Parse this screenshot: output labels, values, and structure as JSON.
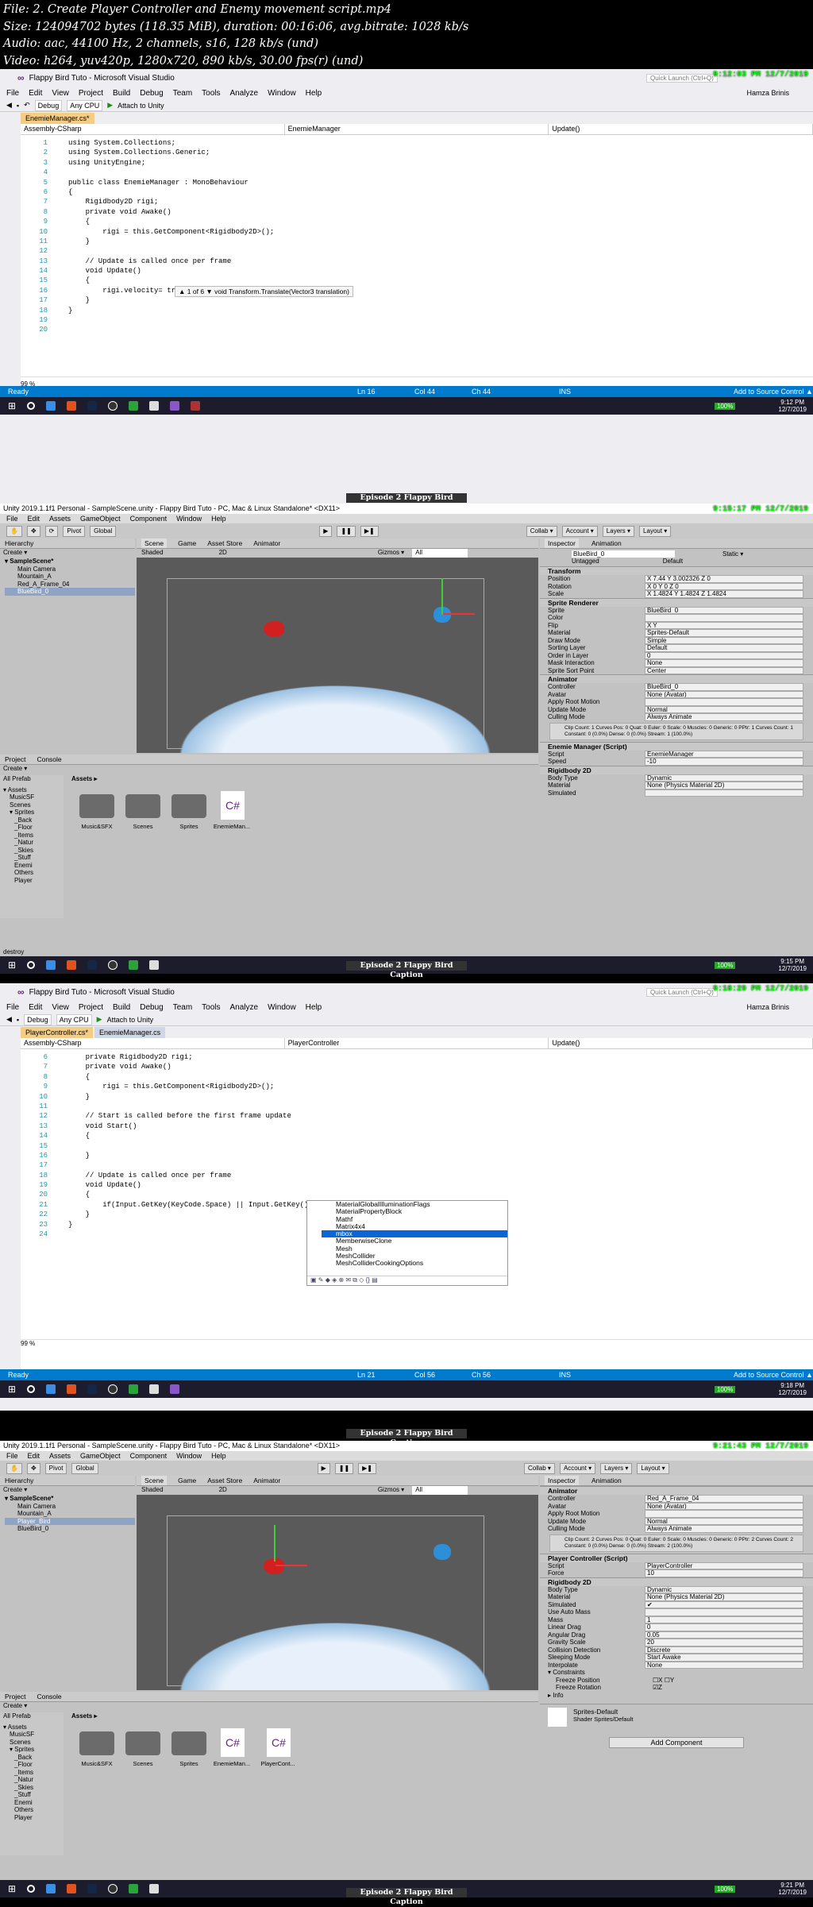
{
  "header": {
    "line1": "File: 2. Create Player Controller and Enemy movement script.mp4",
    "line2": "Size: 124094702 bytes (118.35 MiB), duration: 00:16:06, avg.bitrate: 1028 kb/s",
    "line3": "Audio: aac, 44100 Hz, 2 channels, s16, 128 kb/s (und)",
    "line4": "Video: h264, yuv420p, 1280x720, 890 kb/s, 30.00 fps(r) (und)"
  },
  "frame1": {
    "stamp": "9:12:03 PM 12/7/2019",
    "title": "Flappy Bird Tuto - Microsoft Visual Studio",
    "quick_launch": "Quick Launch (Ctrl+Q)",
    "user": "Hamza Brinis",
    "menu": [
      "File",
      "Edit",
      "View",
      "Project",
      "Build",
      "Debug",
      "Team",
      "Tools",
      "Analyze",
      "Window",
      "Help"
    ],
    "config": "Debug",
    "platform": "Any CPU",
    "attach": "Attach to Unity",
    "tab": "EnemieManager.cs*",
    "nav": [
      "Assembly-CSharp",
      "EnemieManager",
      "Update()"
    ],
    "lines": [
      "1",
      "2",
      "3",
      "4",
      "5",
      "6",
      "7",
      "8",
      "9",
      "10",
      "11",
      "12",
      "13",
      "14",
      "15",
      "16",
      "17",
      "18",
      "19",
      "20"
    ],
    "code": [
      "using System.Collections;",
      "using System.Collections.Generic;",
      "using UnityEngine;",
      "",
      "public class EnemieManager : MonoBehaviour",
      "{",
      "    Rigidbody2D rigi;",
      "    private void Awake()",
      "    {",
      "        rigi = this.GetComponent<Rigidbody2D>();",
      "    }",
      "",
      "    // Update is called once per frame",
      "    void Update()",
      "    {",
      "        rigi.velocity= transform.Translate()",
      "    }",
      "}",
      "",
      ""
    ],
    "tooltip": "▲ 1 of 6 ▼  void Transform.Translate(Vector3 translation)",
    "zoom": "99 %",
    "status": {
      "ready": "Ready",
      "ln": "Ln 16",
      "col": "Col 44",
      "ch": "Ch 44",
      "ins": "INS",
      "source": "Add to Source Control ▲"
    },
    "clock": {
      "time": "9:12 PM",
      "date": "12/7/2019"
    }
  },
  "frame2": {
    "stamp": "9:15:17 PM 12/7/2019",
    "title": "Unity 2019.1.1f1 Personal - SampleScene.unity - Flappy Bird Tuto - PC, Mac & Linux Standalone* <DX11>",
    "menu": [
      "File",
      "Edit",
      "Assets",
      "GameObject",
      "Component",
      "Window",
      "Help"
    ],
    "toolbar": {
      "pivot": "Pivot",
      "global": "Global",
      "collab": "Collab ▾",
      "account": "Account ▾",
      "layers": "Layers ▾",
      "layout": "Layout ▾"
    },
    "hierarchy": {
      "tab": "Hierarchy",
      "create": "Create ▾",
      "items": [
        "▾ SampleScene*",
        "Main Camera",
        "Mountain_A",
        "Red_A_Frame_04",
        "BlueBird_0"
      ]
    },
    "scene_tabs": [
      "Scene",
      "Game",
      "Asset Store",
      "Animator"
    ],
    "scene_opts": {
      "shaded": "Shaded",
      "mode": "2D",
      "gizmos": "Gizmos ▾",
      "search": "All"
    },
    "inspector": {
      "tabs": [
        "Inspector",
        "Animation"
      ],
      "object": "BlueBird_0",
      "static": "Static ▾",
      "tag": "Untagged",
      "layer": "Default",
      "transform": "Transform",
      "rows": [
        [
          "Position",
          "X 7.44   Y 3.002326   Z 0"
        ],
        [
          "Rotation",
          "X 0   Y 0   Z 0"
        ],
        [
          "Scale",
          "X 1.4824   Y 1.4824   Z 1.4824"
        ]
      ],
      "sprite_renderer": "Sprite Renderer",
      "sr_rows": [
        [
          "Sprite",
          "BlueBird_0"
        ],
        [
          "Color",
          ""
        ],
        [
          "Flip",
          "X  Y"
        ],
        [
          "Material",
          "Sprites-Default"
        ],
        [
          "Draw Mode",
          "Simple"
        ],
        [
          "Sorting Layer",
          "Default"
        ],
        [
          "Order in Layer",
          "0"
        ],
        [
          "Mask Interaction",
          "None"
        ],
        [
          "Sprite Sort Point",
          "Center"
        ]
      ],
      "animator": "Animator",
      "an_rows": [
        [
          "Controller",
          "BlueBird_0"
        ],
        [
          "Avatar",
          "None (Avatar)"
        ],
        [
          "Apply Root Motion",
          ""
        ],
        [
          "Update Mode",
          "Normal"
        ],
        [
          "Culling Mode",
          "Always Animate"
        ]
      ],
      "clip": "Clip Count: 1  Curves Pos: 0 Quat: 0 Euler: 0 Scale: 0 Muscles: 0 Generic: 0 PPtr: 1  Curves Count: 1 Constant: 0 (0.0%) Dense: 0 (0.0%) Stream: 1 (100.0%)",
      "script_comp": "Enemie Manager (Script)",
      "script_rows": [
        [
          "Script",
          "EnemieManager"
        ],
        [
          "Speed",
          "-10"
        ]
      ],
      "rigidbody": "Rigidbody 2D",
      "rb_rows": [
        [
          "Body Type",
          "Dynamic"
        ],
        [
          "Material",
          "None (Physics Material 2D)"
        ],
        [
          "Simulated",
          ""
        ]
      ]
    },
    "project": {
      "tabs": [
        "Project",
        "Console"
      ],
      "create": "Create ▾",
      "path": "Assets ▸",
      "favorites": "All Prefab",
      "tree": [
        "▾ Assets",
        "MusicSF",
        "Scenes",
        "▾ Sprites",
        "_Back",
        "_Floor",
        "_Items",
        "_Natur",
        "_Skies",
        "_Stuff",
        "Enemi",
        "Others",
        "Player"
      ],
      "assets": [
        "Music&SFX",
        "Scenes",
        "Sprites",
        "EnemieMan..."
      ]
    },
    "console": "destroy",
    "clock": {
      "time": "9:15 PM",
      "date": "12/7/2019"
    }
  },
  "frame3": {
    "stamp": "9:18:29 PM 12/7/2019",
    "title": "Flappy Bird Tuto - Microsoft Visual Studio",
    "quick_launch": "Quick Launch (Ctrl+Q)",
    "user": "Hamza Brinis",
    "tabs": [
      "PlayerController.cs*",
      "EnemieManager.cs"
    ],
    "nav": [
      "Assembly-CSharp",
      "PlayerController",
      "Update()"
    ],
    "lines": [
      "6",
      "7",
      "8",
      "9",
      "10",
      "11",
      "12",
      "13",
      "14",
      "15",
      "16",
      "17",
      "18",
      "19",
      "20",
      "21",
      "22",
      "23",
      "24"
    ],
    "code": [
      "    private Rigidbody2D rigi;",
      "    private void Awake()",
      "    {",
      "        rigi = this.GetComponent<Rigidbody2D>();",
      "    }",
      "",
      "    // Start is called before the first frame update",
      "    void Start()",
      "    {",
      "",
      "    }",
      "",
      "    // Update is called once per frame",
      "    void Update()",
      "    {",
      "        if(Input.GetKey(KeyCode.Space) || Input.GetKey()_",
      "    }",
      "}",
      ""
    ],
    "autocomplete": [
      "MaterialGlobalIlluminationFlags",
      "MaterialPropertyBlock",
      "Mathf",
      "Matrix4x4",
      "mbox",
      "MemberwiseClone",
      "Mesh",
      "MeshCollider",
      "MeshColliderCookingOptions"
    ],
    "zoom": "99 %",
    "status": {
      "ready": "Ready",
      "ln": "Ln 21",
      "col": "Col 56",
      "ch": "Ch 56",
      "ins": "INS",
      "source": "Add to Source Control ▲"
    },
    "clock": {
      "time": "9:18 PM",
      "date": "12/7/2019"
    }
  },
  "frame4": {
    "stamp": "9:21:43 PM 12/7/2019",
    "title": "Unity 2019.1.1f1 Personal - SampleScene.unity - Flappy Bird Tuto - PC, Mac & Linux Standalone* <DX11>",
    "hierarchy": {
      "items": [
        "▾ SampleScene*",
        "Main Camera",
        "Mountain_A",
        "Player_Bird",
        "BlueBird_0"
      ]
    },
    "inspector": {
      "animator": "Animator",
      "an_rows": [
        [
          "Controller",
          "Red_A_Frame_04"
        ],
        [
          "Avatar",
          "None (Avatar)"
        ],
        [
          "Apply Root Motion",
          ""
        ],
        [
          "Update Mode",
          "Normal"
        ],
        [
          "Culling Mode",
          "Always Animate"
        ]
      ],
      "clip": "Clip Count: 2  Curves Pos: 0 Quat: 0 Euler: 0 Scale: 0 Muscles: 0 Generic: 0 PPtr: 2  Curves Count: 2 Constant: 0 (0.0%) Dense: 0 (0.0%) Stream: 2 (100.0%)",
      "script_comp": "Player Controller (Script)",
      "script_rows": [
        [
          "Script",
          "PlayerController"
        ],
        [
          "Force",
          "10"
        ]
      ],
      "rigidbody": "Rigidbody 2D",
      "rb_rows": [
        [
          "Body Type",
          "Dynamic"
        ],
        [
          "Material",
          "None (Physics Material 2D)"
        ],
        [
          "Simulated",
          "✔"
        ],
        [
          "Use Auto Mass",
          ""
        ],
        [
          "Mass",
          "1"
        ],
        [
          "Linear Drag",
          "0"
        ],
        [
          "Angular Drag",
          "0.05"
        ],
        [
          "Gravity Scale",
          "20"
        ],
        [
          "Collision Detection",
          "Discrete"
        ],
        [
          "Sleeping Mode",
          "Start Awake"
        ],
        [
          "Interpolate",
          "None"
        ]
      ],
      "constraints": "▾ Constraints",
      "freeze_pos": "Freeze Position",
      "freeze_rot": "Freeze Rotation",
      "info": "▸ Info",
      "material": "Sprites-Default",
      "shader": "Shader  Sprites/Default",
      "add_component": "Add Component"
    },
    "project": {
      "assets": [
        "Music&SFX",
        "Scenes",
        "Sprites",
        "EnemieMan...",
        "PlayerCont..."
      ]
    },
    "clock": {
      "time": "9:21 PM",
      "date": "12/7/2019"
    }
  },
  "caption": "Episode 2 Flappy Bird Caption",
  "battery": "100%",
  "colors": {
    "vs_status": "#007acc",
    "selection": "#0a66d6",
    "stamp": "#00ff00"
  }
}
